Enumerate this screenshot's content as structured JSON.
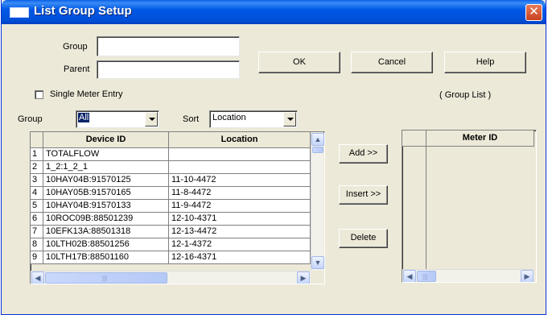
{
  "window": {
    "title": "List Group Setup",
    "close_glyph": "✕"
  },
  "form": {
    "group_label": "Group",
    "group_value": "",
    "parent_label": "Parent",
    "parent_value": "",
    "single_meter_label": "Single Meter Entry",
    "single_meter_checked": false
  },
  "buttons": {
    "ok": "OK",
    "cancel": "Cancel",
    "help": "Help",
    "add": "Add >>",
    "insert": "Insert >>",
    "delete": "Delete"
  },
  "filters": {
    "group_label": "Group",
    "group_value": "All",
    "sort_label": "Sort",
    "sort_value": "Location"
  },
  "group_list_label": "( Group List )",
  "device_table": {
    "columns": [
      "Device ID",
      "Location"
    ],
    "rows": [
      {
        "num": "1",
        "device_id": "TOTALFLOW",
        "location": ""
      },
      {
        "num": "2",
        "device_id": "1_2:1_2_1",
        "location": ""
      },
      {
        "num": "3",
        "device_id": "10HAY04B:91570125",
        "location": "11-10-4472"
      },
      {
        "num": "4",
        "device_id": "10HAY05B:91570165",
        "location": "11-8-4472"
      },
      {
        "num": "5",
        "device_id": "10HAY04B:91570133",
        "location": "11-9-4472"
      },
      {
        "num": "6",
        "device_id": "10ROC09B:88501239",
        "location": "12-10-4371"
      },
      {
        "num": "7",
        "device_id": "10EFK13A:88501318",
        "location": "12-13-4472"
      },
      {
        "num": "8",
        "device_id": "10LTH02B:88501256",
        "location": "12-1-4372"
      },
      {
        "num": "9",
        "device_id": "10LTH17B:88501160",
        "location": "12-16-4371"
      }
    ]
  },
  "group_table": {
    "columns": [
      "Meter ID"
    ],
    "rows": []
  },
  "icons": [
    "window-icon",
    "close-icon",
    "dropdown-arrow-icon",
    "scroll-up-icon",
    "scroll-down-icon",
    "scroll-left-icon",
    "scroll-right-icon"
  ]
}
